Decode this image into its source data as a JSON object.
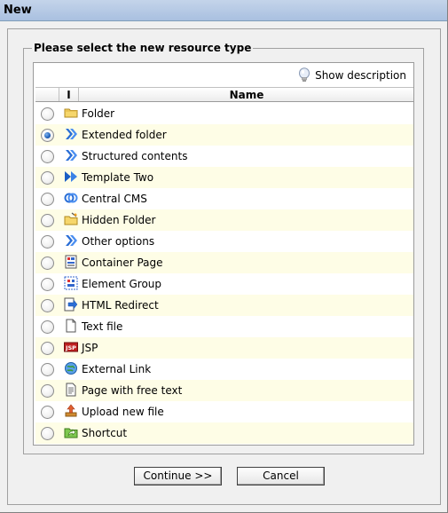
{
  "window": {
    "title": "New"
  },
  "fieldset": {
    "legend": "Please select the new resource type"
  },
  "panel": {
    "show_description": "Show description"
  },
  "table": {
    "col_i": "I",
    "col_name": "Name"
  },
  "resource_types": [
    {
      "label": "Folder",
      "icon": "folder-icon",
      "selected": false
    },
    {
      "label": "Extended folder",
      "icon": "double-chevron-icon",
      "selected": true
    },
    {
      "label": "Structured contents",
      "icon": "double-chevron-icon",
      "selected": false
    },
    {
      "label": "Template Two",
      "icon": "fast-forward-icon",
      "selected": false
    },
    {
      "label": "Central CMS",
      "icon": "rings-icon",
      "selected": false
    },
    {
      "label": "Hidden Folder",
      "icon": "hidden-folder-icon",
      "selected": false
    },
    {
      "label": "Other options",
      "icon": "double-chevron-icon",
      "selected": false
    },
    {
      "label": "Container Page",
      "icon": "container-page-icon",
      "selected": false
    },
    {
      "label": "Element Group",
      "icon": "element-group-icon",
      "selected": false
    },
    {
      "label": "HTML Redirect",
      "icon": "redirect-icon",
      "selected": false
    },
    {
      "label": "Text file",
      "icon": "text-file-icon",
      "selected": false
    },
    {
      "label": "JSP",
      "icon": "jsp-icon",
      "selected": false
    },
    {
      "label": "External Link",
      "icon": "external-link-icon",
      "selected": false
    },
    {
      "label": "Page with free text",
      "icon": "free-text-page-icon",
      "selected": false
    },
    {
      "label": "Upload new file",
      "icon": "upload-icon",
      "selected": false
    },
    {
      "label": "Shortcut",
      "icon": "shortcut-icon",
      "selected": false
    }
  ],
  "buttons": {
    "continue": "Continue >>",
    "cancel": "Cancel"
  }
}
